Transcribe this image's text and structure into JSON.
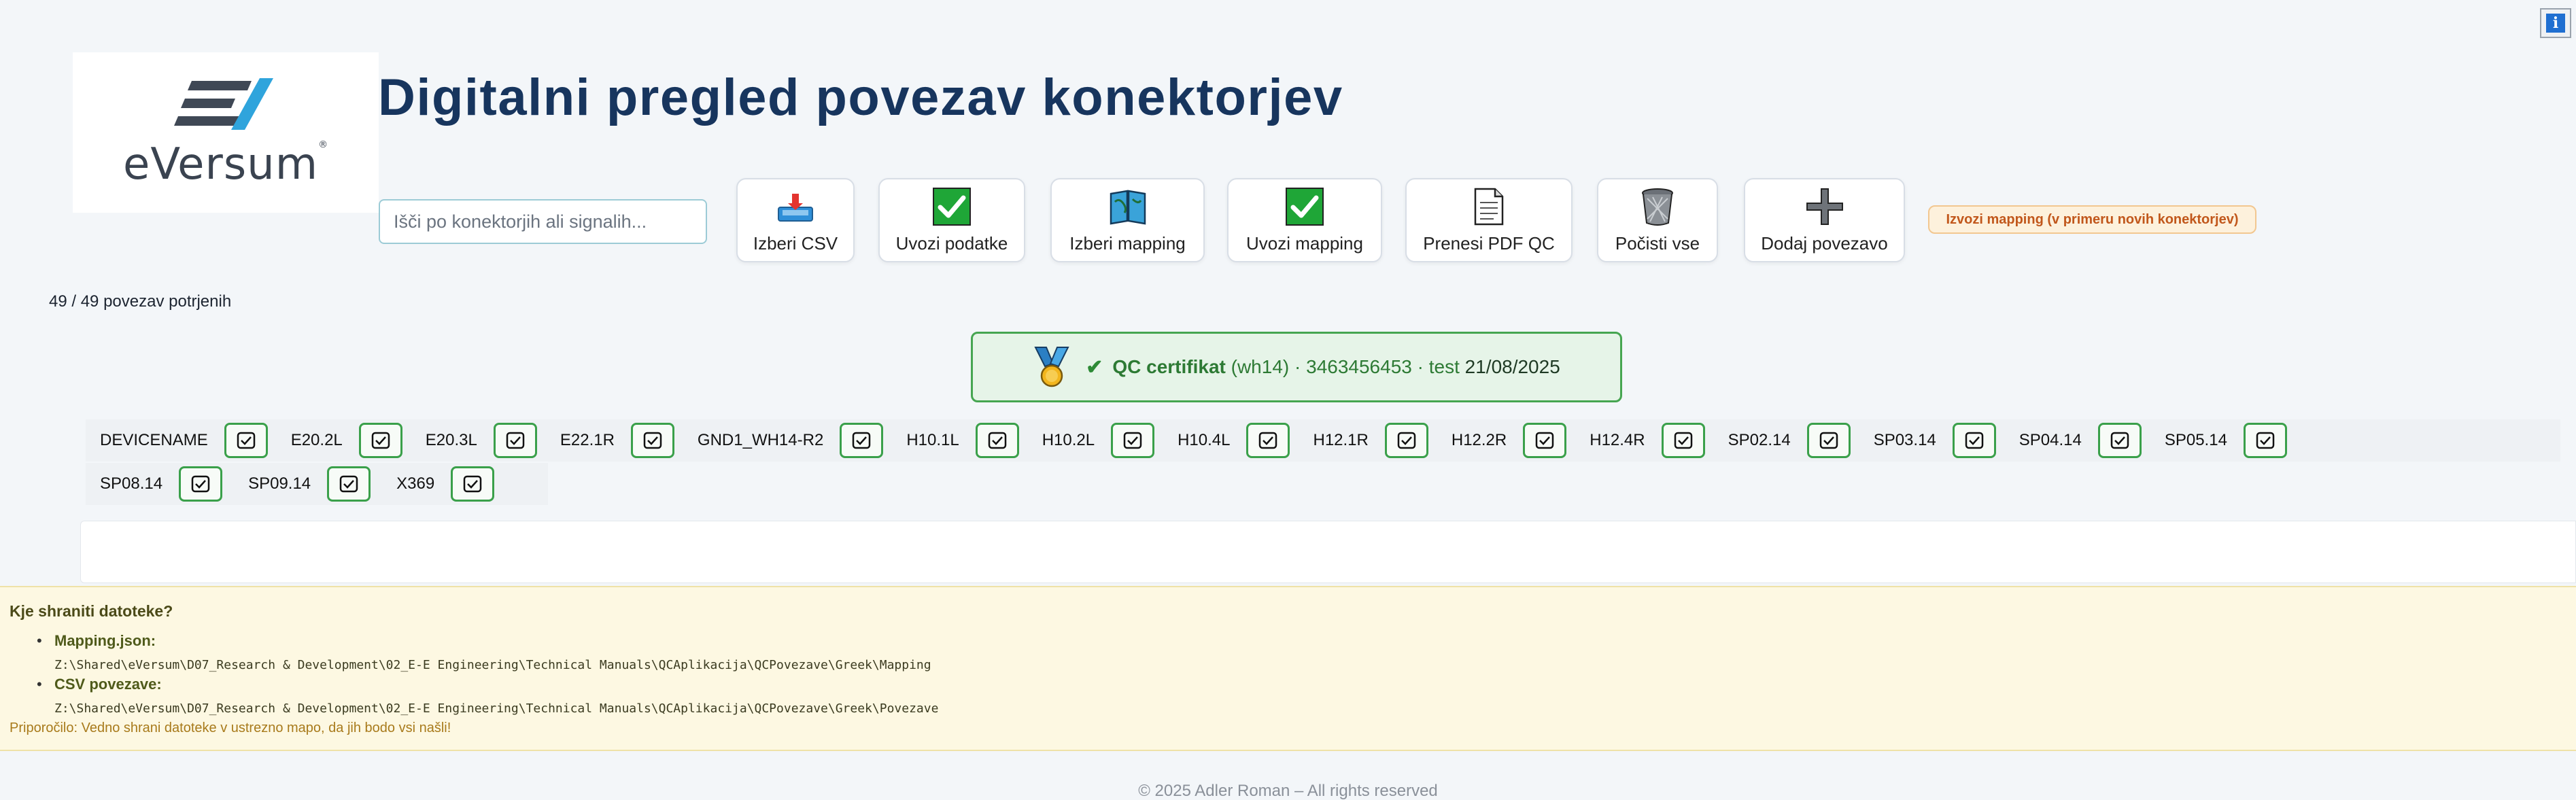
{
  "header": {
    "logo_text": "eVersum",
    "title": "Digitalni pregled povezav konektorjev"
  },
  "search": {
    "placeholder": "Išči po konektorjih ali signalih..."
  },
  "toolbar": {
    "select_csv": "Izberi CSV",
    "import_data": "Uvozi podatke",
    "select_mapping": "Izberi mapping",
    "import_mapping": "Uvozi mapping",
    "download_pdf": "Prenesi PDF QC",
    "clear_all": "Počisti vse",
    "add_connection": "Dodaj povezavo"
  },
  "export_badge": "Izvozi mapping (v primeru novih konektorjev)",
  "status": {
    "confirmed": "49 / 49 povezav potrjenih"
  },
  "qc": {
    "label": "QC certifikat",
    "harness": "(wh14)",
    "serial": "· 3463456453 · test",
    "date": "21/08/2025"
  },
  "devices": [
    "DEVICENAME",
    "E20.2L",
    "E20.3L",
    "E22.1R",
    "GND1_WH14-R2",
    "H10.1L",
    "H10.2L",
    "H10.4L",
    "H12.1R",
    "H12.2R",
    "H12.4R",
    "SP02.14",
    "SP03.14",
    "SP04.14",
    "SP05.14",
    "SP08.14",
    "SP09.14",
    "X369"
  ],
  "info": {
    "heading": "Kje shraniti datoteke?",
    "mapping_title": "Mapping.json:",
    "mapping_path": "Z:\\Shared\\eVersum\\D07_Research & Development\\02_E-E Engineering\\Technical Manuals\\QCAplikacija\\QCPovezave\\Greek\\Mapping",
    "csv_title": "CSV povezave:",
    "csv_path": "Z:\\Shared\\eVersum\\D07_Research & Development\\02_E-E Engineering\\Technical Manuals\\QCAplikacija\\QCPovezave\\Greek\\Povezave",
    "tip": "Priporočilo: Vedno shrani datoteke v ustrezno mapo, da jih bodo vsi našli!"
  },
  "footer": "© 2025 Adler Roman – All rights reserved",
  "colors": {
    "title": "#17355e",
    "accent_green": "#46a551",
    "badge_orange": "#c1571b"
  }
}
